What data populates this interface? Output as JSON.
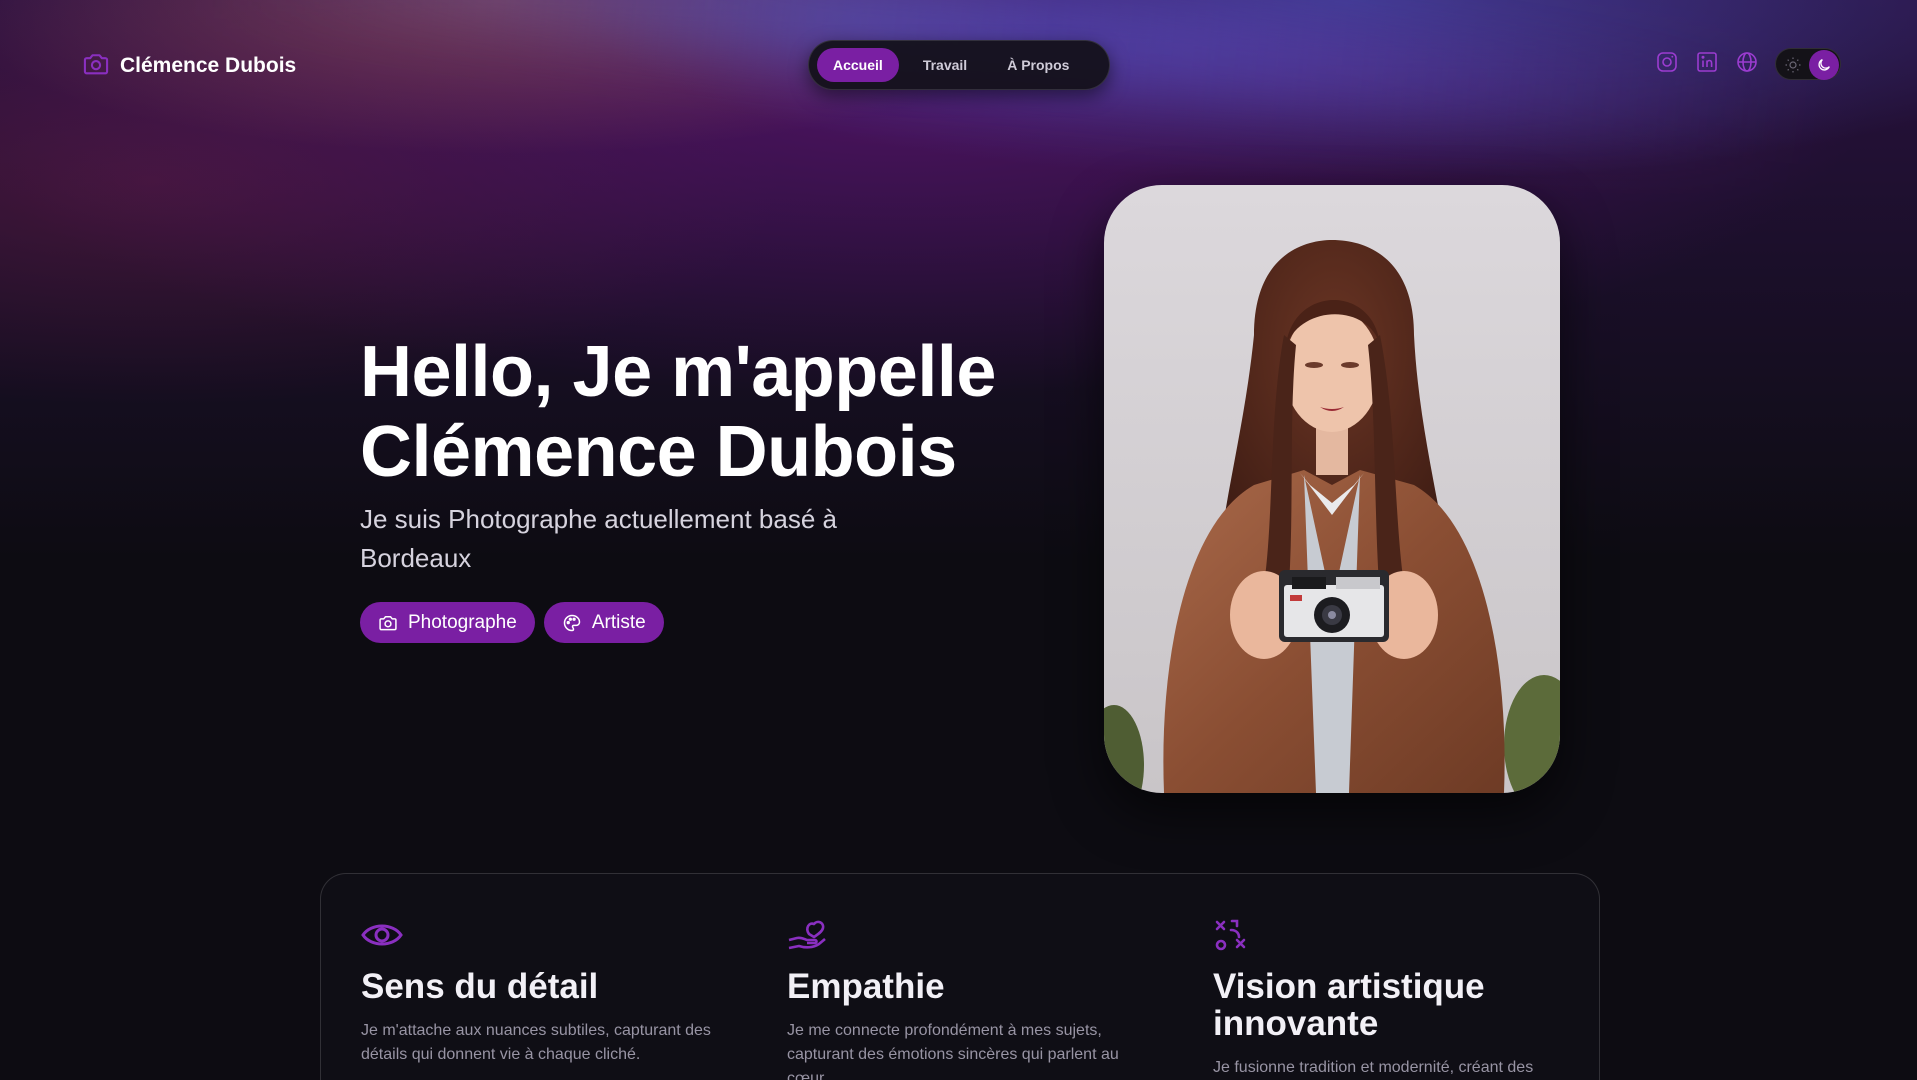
{
  "header": {
    "brand_name": "Clémence Dubois",
    "brand_icon": "camera-icon",
    "nav": [
      {
        "label": "Accueil",
        "active": true
      },
      {
        "label": "Travail",
        "active": false
      },
      {
        "label": "À Propos",
        "active": false
      }
    ],
    "socials": [
      "instagram-icon",
      "linkedin-icon",
      "globe-icon"
    ],
    "theme_toggle": {
      "mode": "dark"
    }
  },
  "hero": {
    "title_line1": "Hello, Je m'appelle",
    "title_line2": "Clémence Dubois",
    "subtitle": "Je suis Photographe actuellement basé à Bordeaux",
    "tags": [
      {
        "label": "Photographe",
        "icon": "camera-icon"
      },
      {
        "label": "Artiste",
        "icon": "palette-icon"
      }
    ]
  },
  "features": [
    {
      "icon": "eye-icon",
      "title": "Sens du détail",
      "text": "Je m'attache aux nuances subtiles, capturant des détails qui donnent vie à chaque cliché."
    },
    {
      "icon": "heart-hand-icon",
      "title": "Empathie",
      "text": "Je me connecte profondément à mes sujets, capturant des émotions sincères qui parlent au cœur."
    },
    {
      "icon": "strategy-icon",
      "title": "Vision artistique innovante",
      "text": "Je fusionne tradition et modernité, créant des"
    }
  ],
  "colors": {
    "accent": "#7a1fa3",
    "background": "#0d0c12"
  }
}
